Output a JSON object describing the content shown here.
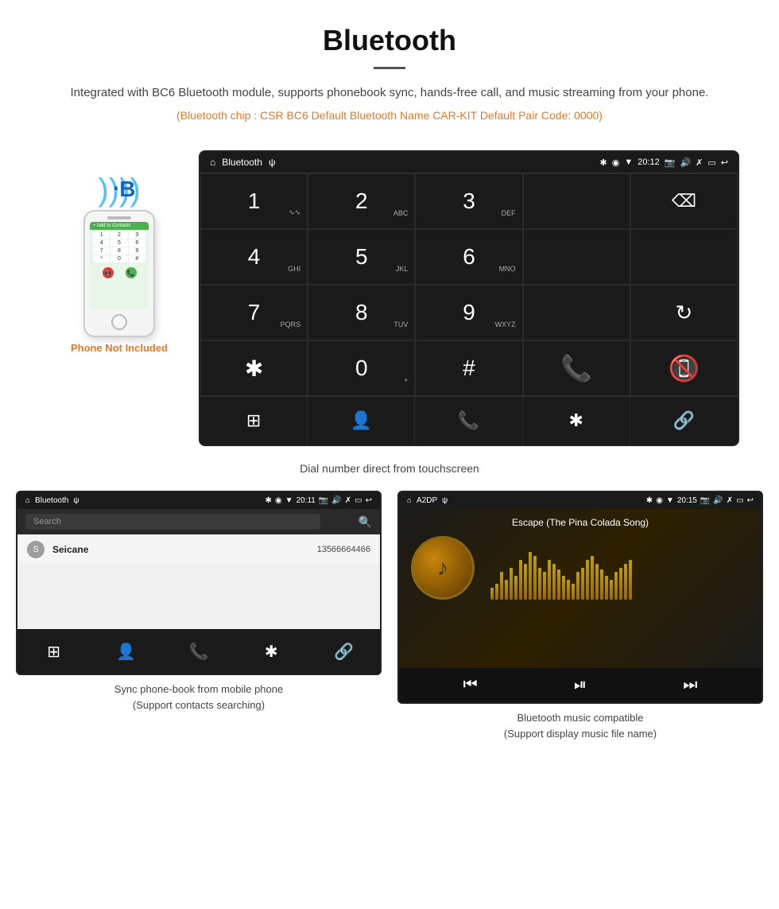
{
  "header": {
    "title": "Bluetooth",
    "description": "Integrated with BC6 Bluetooth module, supports phonebook sync, hands-free call, and music streaming from your phone.",
    "specs": "(Bluetooth chip : CSR BC6    Default Bluetooth Name CAR-KIT    Default Pair Code: 0000)"
  },
  "dialpad": {
    "statusbar": {
      "left": "🏠  Bluetooth  ψ",
      "time": "20:12",
      "right": "📷  🔊  ✗  ▭  ↩"
    },
    "keys": [
      {
        "main": "1",
        "sub": "∿∿"
      },
      {
        "main": "2",
        "sub": "ABC"
      },
      {
        "main": "3",
        "sub": "DEF"
      },
      {
        "main": "",
        "sub": ""
      },
      {
        "main": "⌫",
        "sub": ""
      },
      {
        "main": "4",
        "sub": "GHI"
      },
      {
        "main": "5",
        "sub": "JKL"
      },
      {
        "main": "6",
        "sub": "MNO"
      },
      {
        "main": "",
        "sub": ""
      },
      {
        "main": "",
        "sub": ""
      },
      {
        "main": "7",
        "sub": "PQRS"
      },
      {
        "main": "8",
        "sub": "TUV"
      },
      {
        "main": "9",
        "sub": "WXYZ"
      },
      {
        "main": "",
        "sub": ""
      },
      {
        "main": "↻",
        "sub": ""
      },
      {
        "main": "✱",
        "sub": ""
      },
      {
        "main": "0",
        "sub": "+"
      },
      {
        "main": "#",
        "sub": ""
      },
      {
        "main": "📞",
        "sub": ""
      },
      {
        "main": "📵",
        "sub": ""
      }
    ],
    "bottomNav": [
      "⊞",
      "👤",
      "📞",
      "✱",
      "🔗"
    ]
  },
  "dialCaption": "Dial number direct from touchscreen",
  "phonebook": {
    "statusbar": {
      "left": "🏠  Bluetooth  ψ",
      "time": "20:11",
      "right": "📷 🔊 ✗ ▭ ↩"
    },
    "searchPlaceholder": "Search",
    "contact": {
      "letter": "S",
      "name": "Seicane",
      "number": "13566664466"
    },
    "caption_line1": "Sync phone-book from mobile phone",
    "caption_line2": "(Support contacts searching)"
  },
  "music": {
    "statusbar": {
      "left": "🏠  A2DP  ψ",
      "time": "20:15",
      "right": "📷 🔊 ✗ ▭ ↩"
    },
    "songTitle": "Escape (The Pina Colada Song)",
    "caption_line1": "Bluetooth music compatible",
    "caption_line2": "(Support display music file name)"
  },
  "phoneNotIncluded": "Phone Not Included",
  "eqBarHeights": [
    15,
    20,
    35,
    25,
    40,
    30,
    50,
    45,
    60,
    55,
    40,
    35,
    50,
    45,
    38,
    30,
    25,
    20,
    35,
    40,
    50,
    55,
    45,
    38,
    30,
    25,
    35,
    40,
    45,
    50
  ]
}
